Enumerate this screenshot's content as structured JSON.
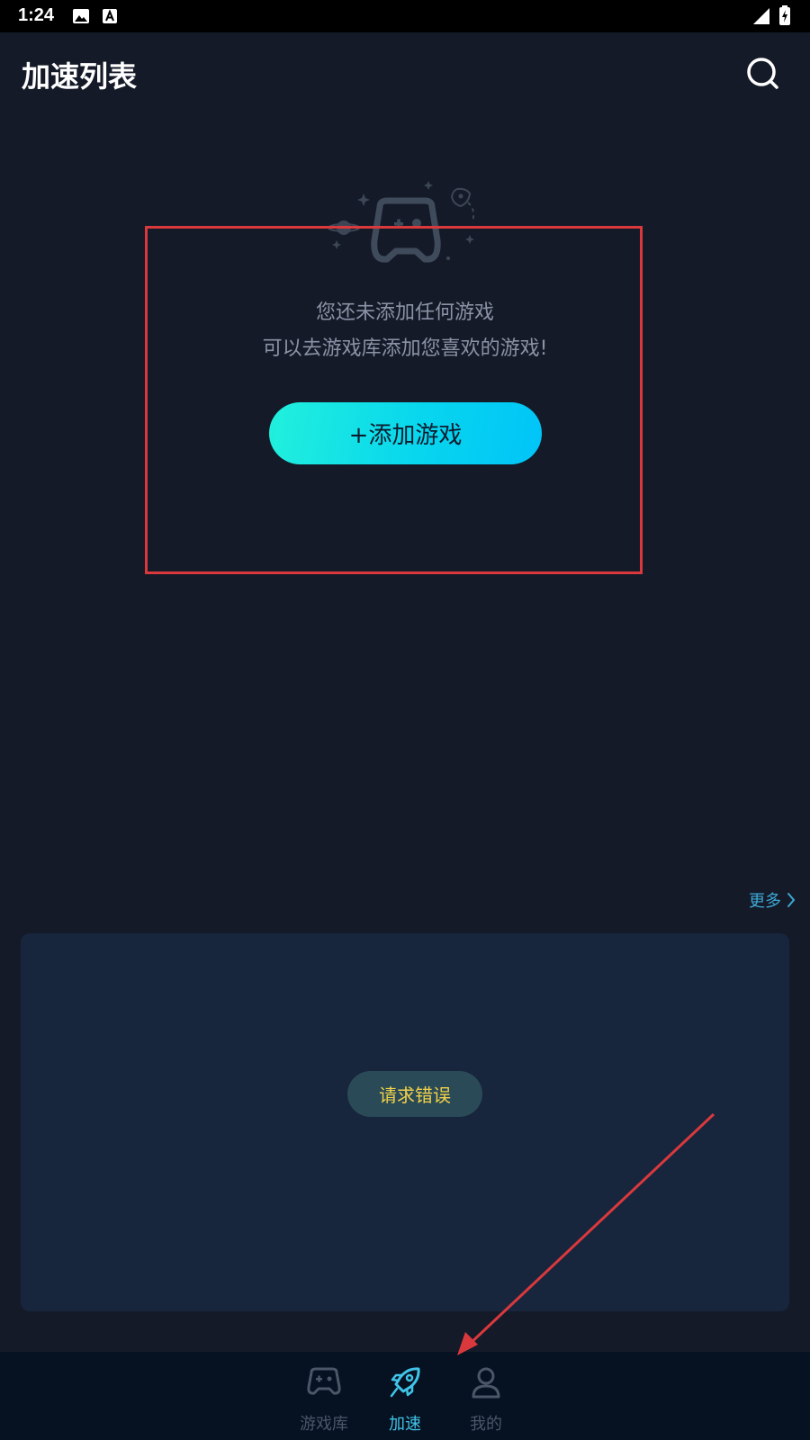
{
  "status_bar": {
    "time": "1:24"
  },
  "header": {
    "title": "加速列表"
  },
  "empty_state": {
    "line1": "您还未添加任何游戏",
    "line2": "可以去游戏库添加您喜欢的游戏!",
    "add_button_label": "+添加游戏"
  },
  "more": {
    "label": "更多"
  },
  "banner": {
    "error_label": "请求错误"
  },
  "bottom_nav": {
    "items": [
      {
        "label": "游戏库",
        "icon": "gamepad-icon",
        "active": false
      },
      {
        "label": "加速",
        "icon": "rocket-icon",
        "active": true
      },
      {
        "label": "我的",
        "icon": "user-icon",
        "active": false
      }
    ]
  },
  "colors": {
    "background": "#141a28",
    "accent": "#40c4e8",
    "button_gradient_start": "#22f0dc",
    "button_gradient_end": "#00c4f8",
    "error_text": "#f3d14a",
    "annotation": "#d9393c"
  }
}
